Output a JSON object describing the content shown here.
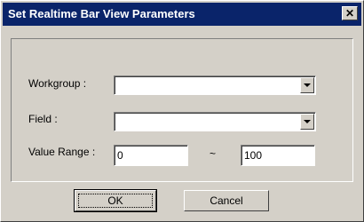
{
  "window": {
    "title": "Set Realtime Bar View Parameters"
  },
  "titlebar": {
    "close_glyph": "✕"
  },
  "fields": {
    "workgroup_label": "Workgroup :",
    "workgroup_value": "",
    "field_label": "Field :",
    "field_value": "",
    "value_range_label": "Value Range :",
    "range_min": "0",
    "range_separator": "~",
    "range_max": "100"
  },
  "buttons": {
    "ok_label": "OK",
    "cancel_label": "Cancel"
  },
  "colors": {
    "titlebar": "#0a246a",
    "dialog_bg": "#d4d0c8"
  },
  "icons": {
    "close": "close-icon",
    "dropdown": "chevron-down-icon"
  }
}
